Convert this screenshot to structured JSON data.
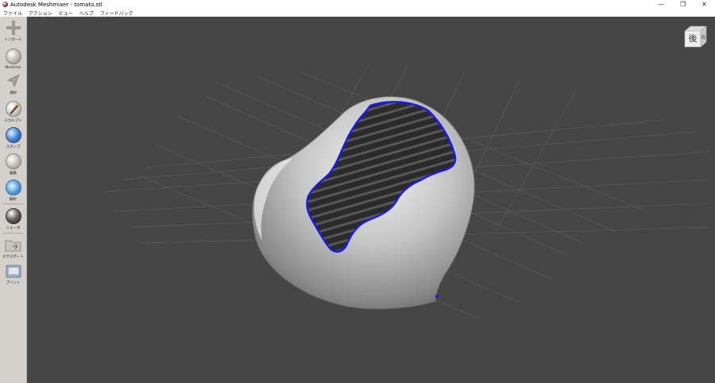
{
  "window": {
    "title": "Autodesk Meshmixer - tomato.stl",
    "minimize": "—",
    "restore": "❐",
    "close": "✕"
  },
  "menu": [
    "ファイル",
    "アクション",
    "ビュー",
    "ヘルプ",
    "フィードバック"
  ],
  "tools": [
    {
      "label": "インポート",
      "icon": "plus-icon"
    },
    {
      "label": "Meshmix",
      "icon": "meshmix-sphere-icon"
    },
    {
      "label": "選択",
      "icon": "select-arrow-icon"
    },
    {
      "label": "スカルプト",
      "icon": "sculpt-brush-icon"
    },
    {
      "label": "スタンプ",
      "icon": "stamp-icon"
    },
    {
      "label": "編集",
      "icon": "edit-sphere-icon"
    },
    {
      "label": "解析",
      "icon": "analysis-sphere-icon"
    },
    {
      "label": "シェーダ",
      "icon": "shader-sphere-icon"
    },
    {
      "label": "エクスポート",
      "icon": "export-folder-icon"
    },
    {
      "label": "プリント",
      "icon": "print-icon"
    }
  ],
  "viewcube": {
    "face_label": "後",
    "side_label": "右"
  },
  "colors": {
    "viewport_bg": "#464646",
    "toolbar_bg": "#d4d0cc",
    "boundary": "#1a1aff"
  }
}
